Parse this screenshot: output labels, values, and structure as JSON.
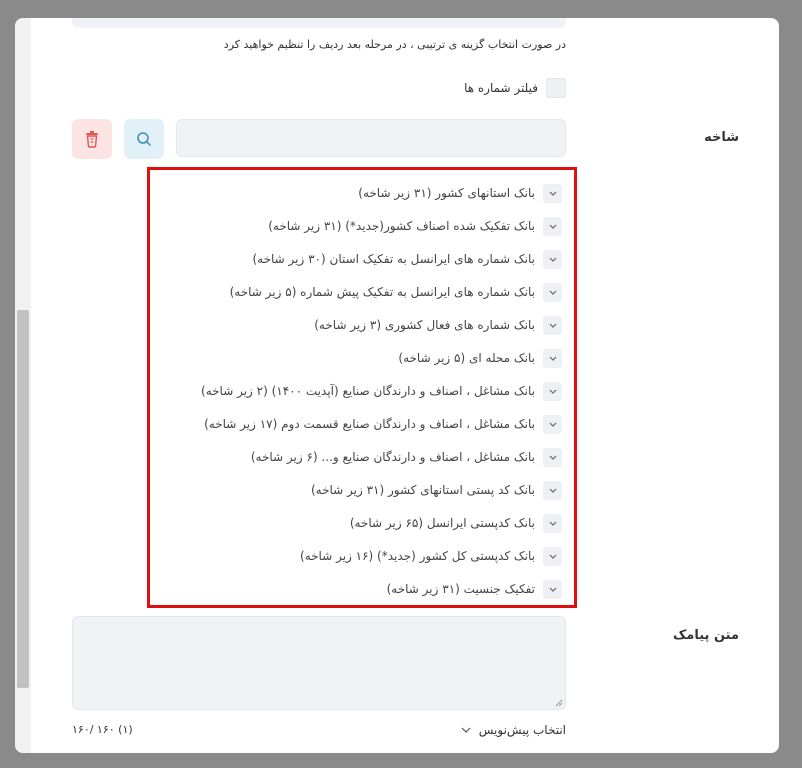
{
  "form": {
    "hint_text": "در صورت انتخاب گزینه ی ترتیبی ، در مرحله بعد ردیف را تنظیم خواهید کرد",
    "filter_label": "فیلتر شماره ها",
    "branch_label": "شاخه",
    "sms_label": "متن پیامک",
    "draft_label": "انتخاب پیش‌نویس",
    "counter_text": "۱۶۰/ ۱۶۰ (۱)"
  },
  "tree": {
    "items": [
      "بانک استانهای کشور (۳۱ زیر شاخه)",
      "بانک تفکیک شده اصناف کشور(جدید*) (۳۱ زیر شاخه)",
      "بانک شماره های ایرانسل به تفکیک استان (۳۰ زیر شاخه)",
      "بانک شماره های ایرانسل به تفکیک پیش شماره (۵ زیر شاخه)",
      "بانک شماره های فعال کشوری (۳ زیر شاخه)",
      "بانک محله ای (۵ زیر شاخه)",
      "بانک مشاغل ، اصناف و دارندگان صنایع (آپدیت ۱۴۰۰) (۲ زیر شاخه)",
      "بانک مشاغل ، اصناف و دارندگان صنایع قسمت دوم (۱۷ زیر شاخه)",
      "بانک مشاغل ، اصناف و دارندگان صنایع و... (۶ زیر شاخه)",
      "بانک کد پستی استانهای کشور (۳۱ زیر شاخه)",
      "بانک کدپستی ایرانسل (۶۵ زیر شاخه)",
      "بانک کدپستی کل کشور (جدید*) (۱۶ زیر شاخه)",
      "تفکیک جنسیت (۳۱ زیر شاخه)"
    ]
  },
  "colors": {
    "highlight_border": "#e01010",
    "search_button_bg": "#e2f1f8",
    "delete_button_bg": "#fde4e4",
    "delete_icon": "#e05555",
    "search_icon": "#3a8fb7"
  },
  "icons": {
    "search": "search-icon",
    "delete": "trash-icon",
    "chevron": "chevron-down-icon"
  }
}
